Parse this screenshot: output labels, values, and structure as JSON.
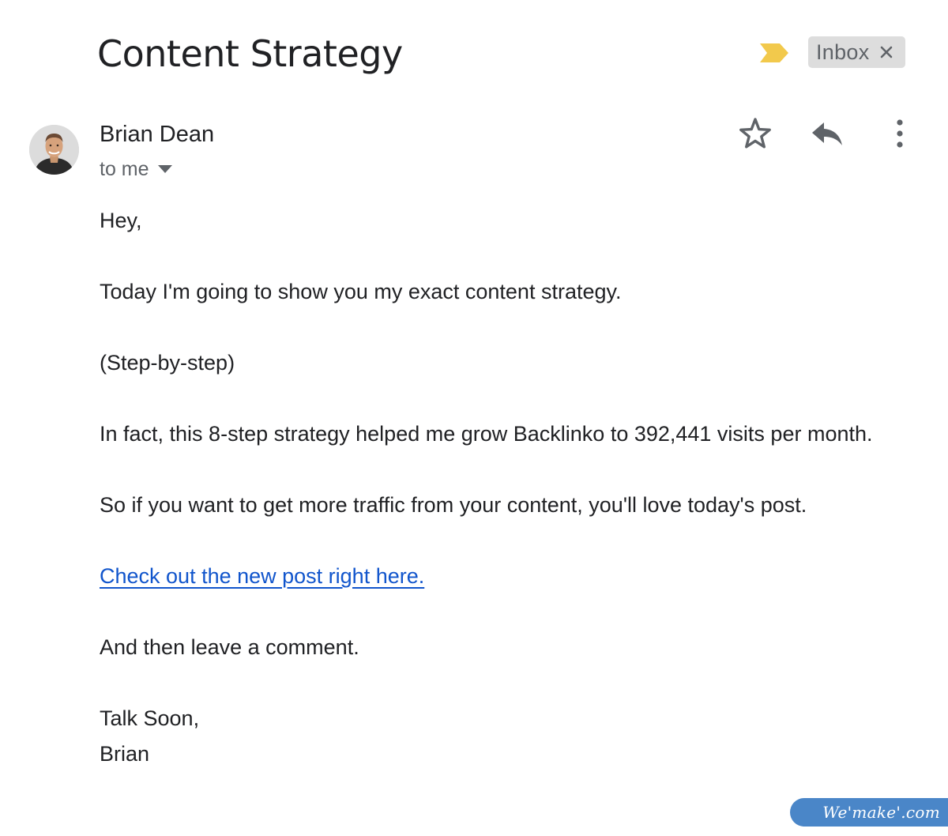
{
  "email": {
    "subject": "Content Strategy",
    "label": "Inbox",
    "sender": {
      "name": "Brian Dean",
      "recipient": "to me"
    },
    "body": {
      "greeting": "Hey,",
      "line1": "Today I'm going to show you my exact content strategy.",
      "line2": "(Step-by-step)",
      "line3": "In fact, this 8-step strategy helped me grow Backlinko to 392,441 visits per month.",
      "line4": "So if you want to get more traffic from your content, you'll love today's post.",
      "link_text": "Check out the new post right here.",
      "line5": "And then leave a comment.",
      "signoff": "Talk Soon,",
      "signature": "Brian"
    }
  },
  "icons": {
    "importance": "importance-marker-icon",
    "label_close": "close-icon",
    "recipient_caret": "caret-down-icon",
    "star": "star-icon",
    "reply": "reply-icon",
    "more": "more-vert-icon"
  },
  "colors": {
    "importance_marker": "#f2c94c",
    "link": "#1155cc",
    "chip_background": "#dddddd",
    "watermark_background": "#4a86c8"
  },
  "watermark": {
    "text": "We'make'.com"
  }
}
